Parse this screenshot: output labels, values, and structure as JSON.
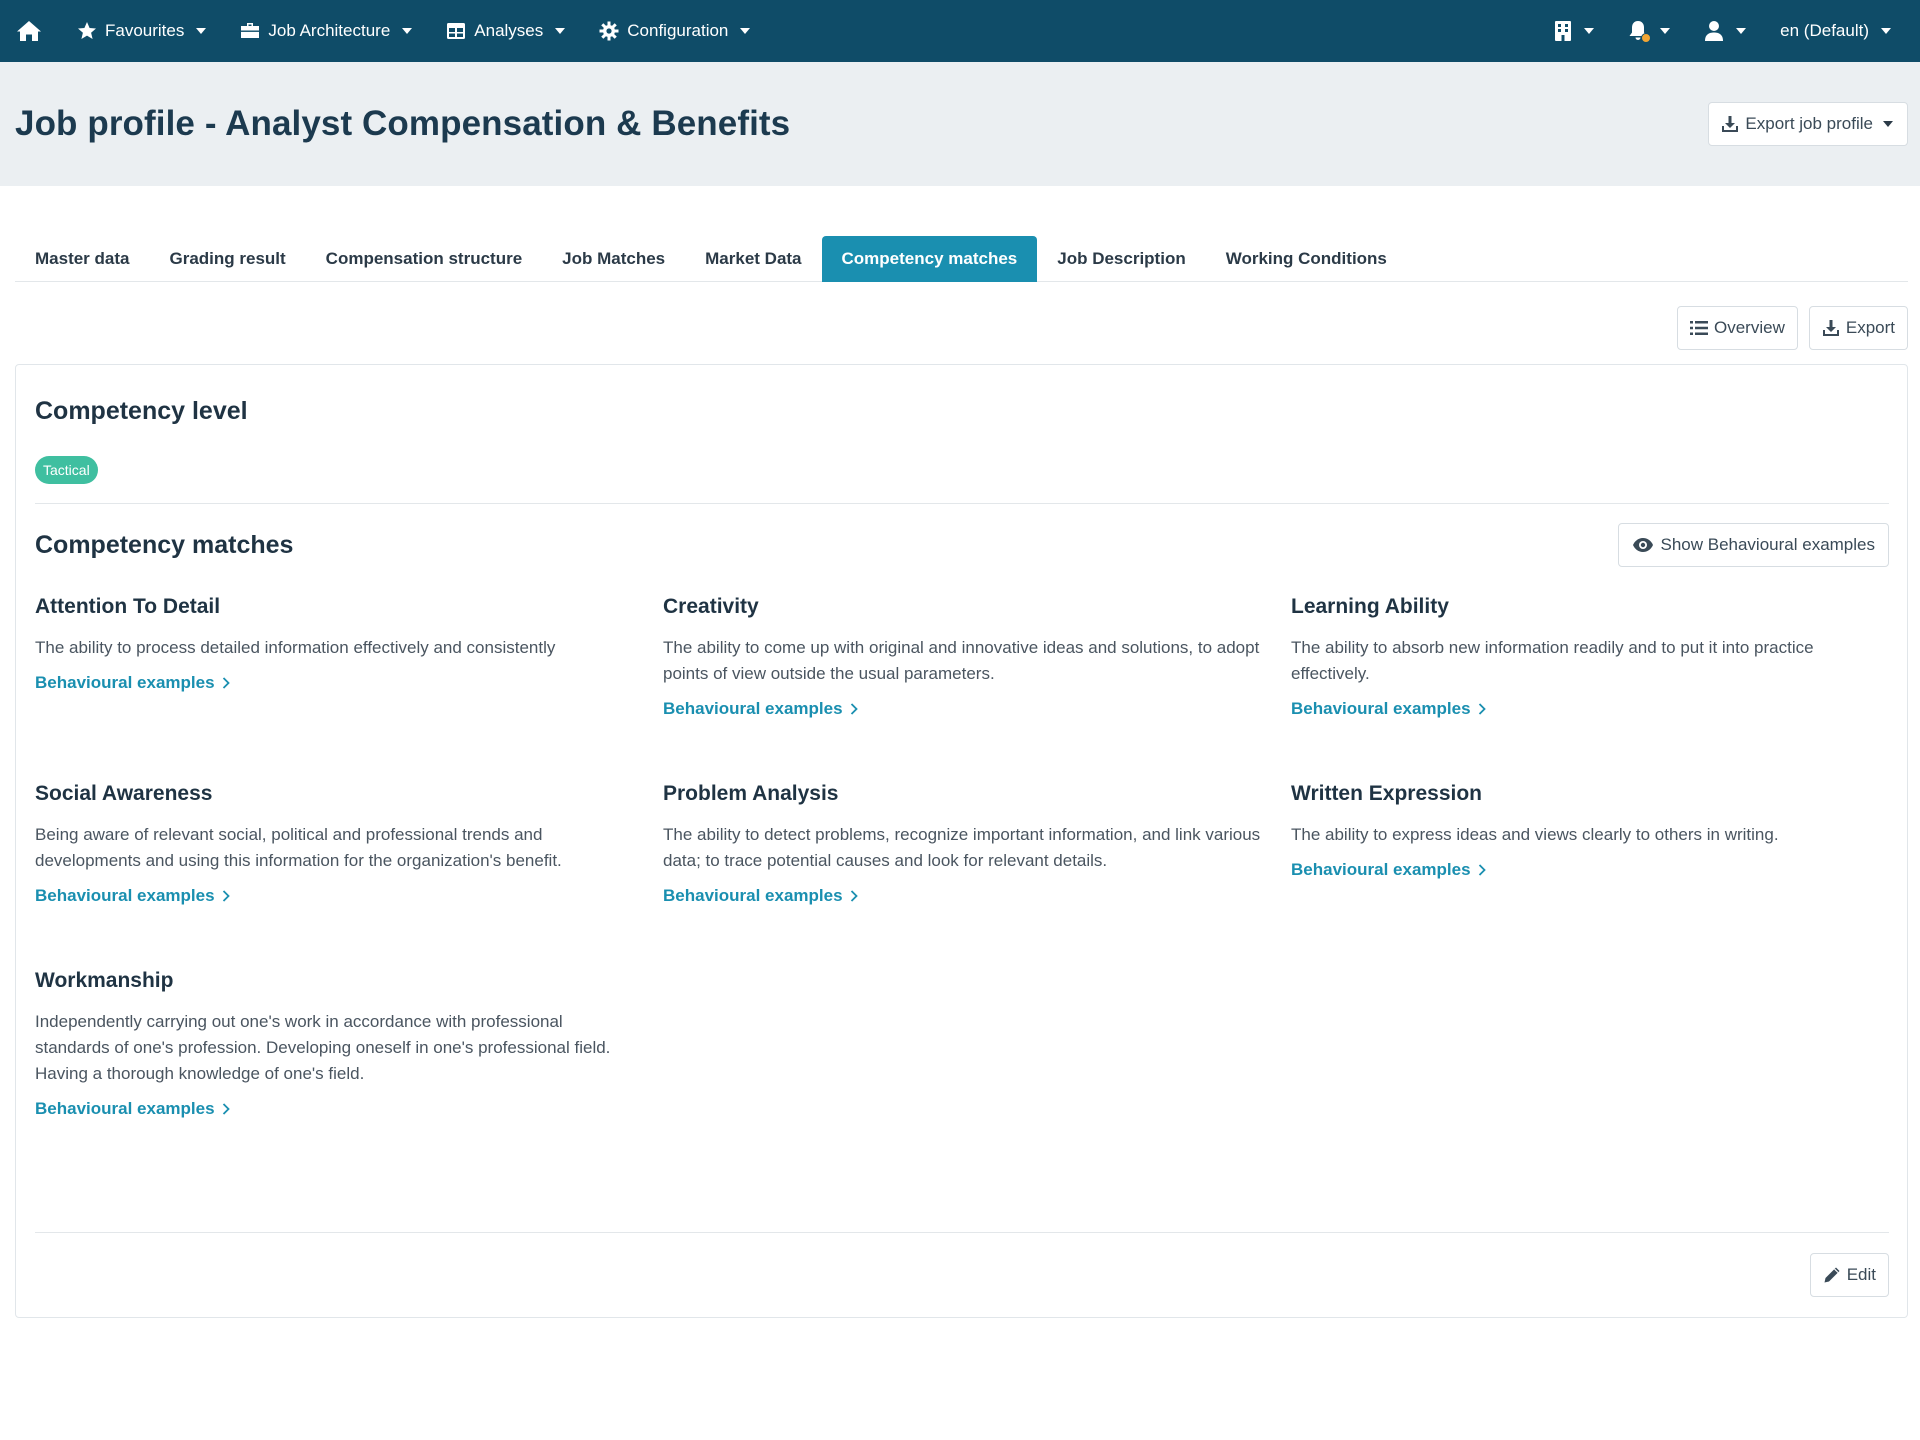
{
  "nav": {
    "favourites": "Favourites",
    "job_architecture": "Job Architecture",
    "analyses": "Analyses",
    "configuration": "Configuration",
    "language": "en (Default)"
  },
  "header": {
    "title": "Job profile - Analyst Compensation & Benefits",
    "export_button": "Export job profile"
  },
  "tabs": [
    {
      "label": "Master data",
      "active": false
    },
    {
      "label": "Grading result",
      "active": false
    },
    {
      "label": "Compensation structure",
      "active": false
    },
    {
      "label": "Job Matches",
      "active": false
    },
    {
      "label": "Market Data",
      "active": false
    },
    {
      "label": "Competency matches",
      "active": true
    },
    {
      "label": "Job Description",
      "active": false
    },
    {
      "label": "Working Conditions",
      "active": false
    }
  ],
  "toolbar": {
    "overview": "Overview",
    "export": "Export"
  },
  "competency_level": {
    "title": "Competency level",
    "badge": "Tactical"
  },
  "competency_matches": {
    "title": "Competency matches",
    "show_examples_button": "Show Behavioural examples",
    "link_label": "Behavioural examples",
    "items": [
      {
        "name": "Attention To Detail",
        "description": "The ability to process detailed information effectively and consistently"
      },
      {
        "name": "Creativity",
        "description": "The ability to come up with original and innovative ideas and solutions, to adopt points of view outside the usual parameters."
      },
      {
        "name": "Learning Ability",
        "description": "The ability to absorb new information readily and to put it into practice effectively."
      },
      {
        "name": "Social Awareness",
        "description": "Being aware of relevant social, political and professional trends and developments and using this information for the organization's benefit."
      },
      {
        "name": "Problem Analysis",
        "description": "The ability to detect problems, recognize important information, and link various data; to trace potential causes and look for relevant details."
      },
      {
        "name": "Written Expression",
        "description": "The ability to express ideas and views clearly to others in writing."
      },
      {
        "name": "Workmanship",
        "description": "Independently carrying out one's work in accordance with professional standards of one's profession. Developing oneself in one's professional field. Having a thorough knowledge of one's field."
      }
    ]
  },
  "footer": {
    "edit": "Edit"
  },
  "colors": {
    "navbar": "#0f4c68",
    "accent": "#1a8fb0",
    "badge": "#3fbfa0",
    "notification": "#f0a534"
  }
}
